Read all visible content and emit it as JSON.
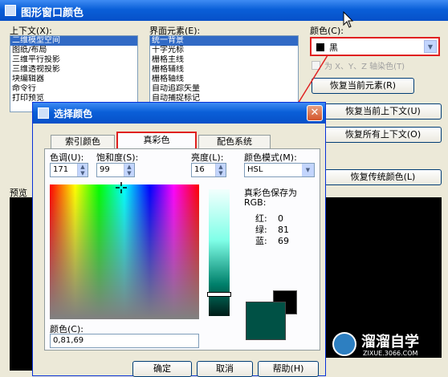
{
  "main_window": {
    "title": "图形窗口颜色",
    "context_label": "上下文(X):",
    "context_items": [
      "二维模型空间",
      "图纸/布局",
      "三维平行投影",
      "三维透视投影",
      "块编辑器",
      "命令行",
      "打印预览"
    ],
    "element_label": "界面元素(E):",
    "element_items": [
      "统一背景",
      "十字光标",
      "栅格主线",
      "栅格辅线",
      "栅格轴线",
      "自动追踪矢量",
      "自动捕捉标记"
    ],
    "color_label": "颜色(C):",
    "color_value": "黑",
    "tint_label": "为 X、Y、Z 轴染色(T)",
    "buttons": [
      "恢复当前元素(R)",
      "恢复当前上下文(U)",
      "恢复所有上下文(O)",
      "恢复传统颜色(L)"
    ],
    "preview_label": "预览"
  },
  "dialog": {
    "title": "选择颜色",
    "tabs": [
      "索引颜色",
      "真彩色",
      "配色系统"
    ],
    "active_tab": "真彩色",
    "hue_label": "色调(U):",
    "hue_value": "171",
    "sat_label": "饱和度(S):",
    "sat_value": "99",
    "lum_label": "亮度(L):",
    "lum_value": "16",
    "model_label": "颜色模式(M):",
    "model_value": "HSL",
    "saved_as_label": "真彩色保存为",
    "rgb_label": "RGB:",
    "rgb_rows": [
      {
        "label": "红:",
        "value": "0"
      },
      {
        "label": "绿:",
        "value": "81"
      },
      {
        "label": "蓝:",
        "value": "69"
      }
    ],
    "color_field_label": "颜色(C):",
    "color_field_value": "0,81,69",
    "ok": "确定",
    "cancel": "取消",
    "help": "帮助(H)"
  },
  "colors": {
    "current_color": "#005145",
    "previous_color": "#000000",
    "highlight": "#e02020",
    "selection": "#316ac5"
  },
  "watermark": {
    "brand": "溜溜自学",
    "url": "ZIXUE.3066.COM"
  }
}
